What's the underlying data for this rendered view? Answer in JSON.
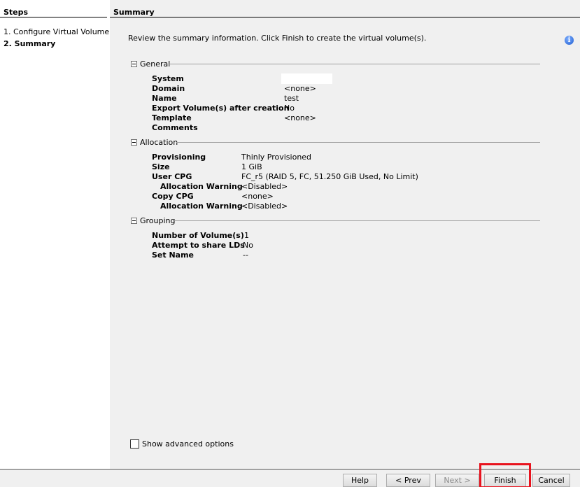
{
  "steps": {
    "header": "Steps",
    "items": [
      "1. Configure Virtual Volume",
      "2. Summary"
    ]
  },
  "summary": {
    "header": "Summary",
    "intro": "Review the summary information. Click Finish to create the virtual volume(s).",
    "info_icon": "info-icon"
  },
  "general": {
    "title": "General",
    "system_label": "System",
    "system_value": "",
    "domain_label": "Domain",
    "domain_value": "<none>",
    "name_label": "Name",
    "name_value": "test",
    "export_label": "Export Volume(s) after creation",
    "export_value": "No",
    "template_label": "Template",
    "template_value": "<none>",
    "comments_label": "Comments",
    "comments_value": ""
  },
  "allocation": {
    "title": "Allocation",
    "provisioning_label": "Provisioning",
    "provisioning_value": "Thinly Provisioned",
    "size_label": "Size",
    "size_value": "1 GiB",
    "user_cpg_label": "User CPG",
    "user_cpg_value": "FC_r5 (RAID 5, FC, 51.250 GiB Used, No Limit)",
    "user_alloc_warning_label": "Allocation Warning",
    "user_alloc_warning_value": "<Disabled>",
    "copy_cpg_label": "Copy CPG",
    "copy_cpg_value": "<none>",
    "copy_alloc_warning_label": "Allocation Warning",
    "copy_alloc_warning_value": "<Disabled>"
  },
  "grouping": {
    "title": "Grouping",
    "num_volumes_label": "Number of Volume(s)",
    "num_volumes_value": "1",
    "share_lds_label": "Attempt to share LDs",
    "share_lds_value": "No",
    "set_name_label": "Set Name",
    "set_name_value": "--"
  },
  "advanced": {
    "label": "Show advanced options",
    "checked": false
  },
  "buttons": {
    "help": "Help",
    "prev": "< Prev",
    "next": "Next >",
    "finish": "Finish",
    "cancel": "Cancel"
  },
  "colors": {
    "highlight": "#e8131e",
    "panel_bg": "#f0f0f0"
  }
}
